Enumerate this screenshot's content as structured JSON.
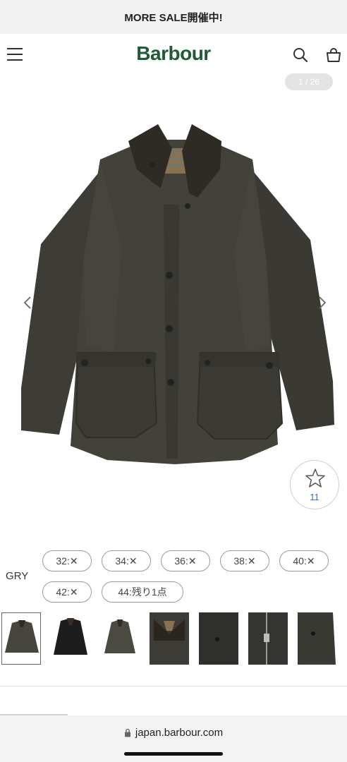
{
  "banner": {
    "text": "MORE SALE開催中!"
  },
  "header": {
    "logo": "Barbour",
    "menu_icon": "hamburger-menu-icon",
    "search_icon": "search-icon",
    "bag_icon": "shopping-bag-icon",
    "logo_color": "#1f5b34"
  },
  "gallery": {
    "counter": "1 / 26",
    "prev_icon": "chevron-left-icon",
    "next_icon": "chevron-right-icon"
  },
  "favorite": {
    "icon": "star-icon",
    "count": "11",
    "count_color": "#2f6fc4"
  },
  "product": {
    "color_label": "GRY",
    "sizes": [
      {
        "label": "32:✕"
      },
      {
        "label": "34:✕"
      },
      {
        "label": "36:✕"
      },
      {
        "label": "38:✕"
      },
      {
        "label": "40:✕"
      },
      {
        "label": "42:✕"
      },
      {
        "label": "44:残り1点"
      }
    ]
  },
  "thumbnails": [
    {
      "name": "thumb-gray-front",
      "selected": true
    },
    {
      "name": "thumb-black-front",
      "selected": false
    },
    {
      "name": "thumb-gray-alt",
      "selected": false
    },
    {
      "name": "thumb-collar-detail",
      "selected": false
    },
    {
      "name": "thumb-pocket-detail",
      "selected": false
    },
    {
      "name": "thumb-zipper-detail",
      "selected": false
    },
    {
      "name": "thumb-sleeve-detail",
      "selected": false
    }
  ],
  "browser": {
    "url": "japan.barbour.com",
    "lock_icon": "lock-icon"
  }
}
